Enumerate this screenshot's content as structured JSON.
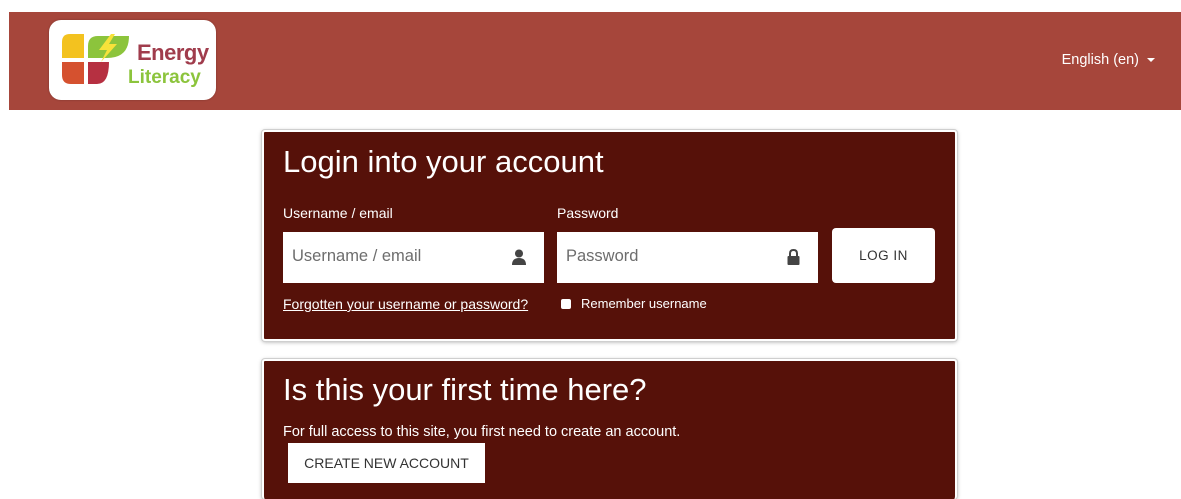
{
  "header": {
    "logo": {
      "line1": "Energy",
      "line2": "Literacy"
    },
    "language_selector": "English (en)"
  },
  "login": {
    "title": "Login into your account",
    "username_label": "Username / email",
    "username_placeholder": "Username / email",
    "password_label": "Password",
    "password_placeholder": "Password",
    "login_button": "LOG IN",
    "forgot_link": "Forgotten your username or password?",
    "remember_label": "Remember username"
  },
  "first_time": {
    "title": "Is this your first time here?",
    "text": "For full access to this site, you first need to create an account.",
    "create_button": "CREATE NEW ACCOUNT"
  },
  "colors": {
    "header_bg": "#a6463b",
    "card_bg": "#561109",
    "logo_red": "#a03c4c",
    "logo_green": "#8cc43c"
  },
  "icons": [
    "logo-leaves-icon",
    "user-icon",
    "lock-icon",
    "caret-down-icon"
  ]
}
